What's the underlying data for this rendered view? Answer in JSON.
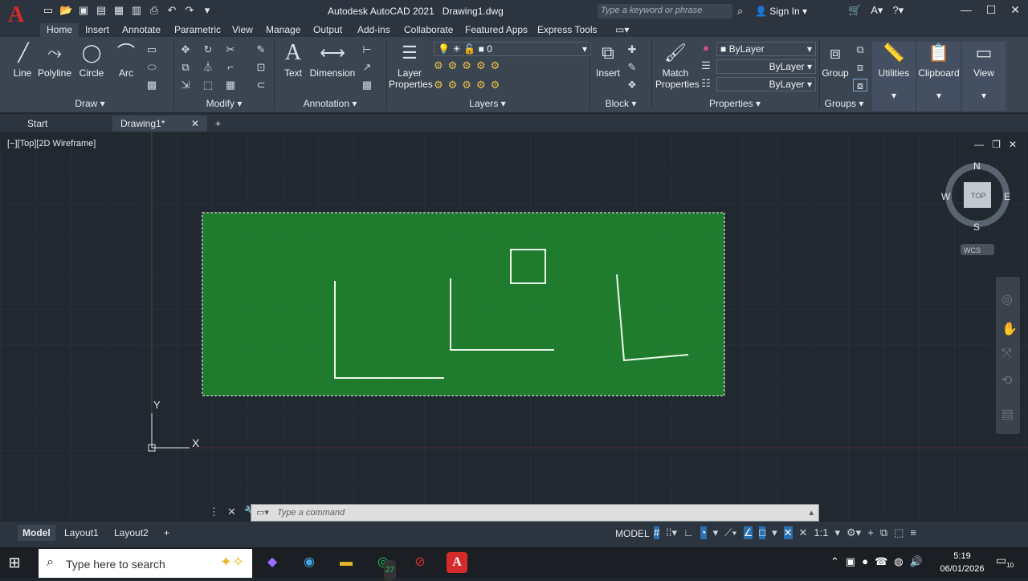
{
  "app": {
    "title": "Autodesk AutoCAD 2021",
    "document": "Drawing1.dwg",
    "search_placeholder": "Type a keyword or phrase",
    "sign_in": "Sign In",
    "logo_letter": "A"
  },
  "ribbon_tabs": [
    "Home",
    "Insert",
    "Annotate",
    "Parametric",
    "View",
    "Manage",
    "Output",
    "Add-ins",
    "Collaborate",
    "Featured Apps",
    "Express Tools"
  ],
  "draw": {
    "line": "Line",
    "polyline": "Polyline",
    "circle": "Circle",
    "arc": "Arc",
    "panel": "Draw"
  },
  "modify": {
    "panel": "Modify"
  },
  "annotation": {
    "text": "Text",
    "dimension": "Dimension",
    "panel": "Annotation"
  },
  "layers": {
    "layer_props_1": "Layer",
    "layer_props_2": "Properties",
    "current_layer": "0",
    "panel": "Layers"
  },
  "block": {
    "insert": "Insert",
    "panel": "Block"
  },
  "properties": {
    "match_1": "Match",
    "match_2": "Properties",
    "color": "ByLayer",
    "linetype": "ByLayer",
    "lineweight": "ByLayer",
    "panel": "Properties"
  },
  "groups": {
    "group": "Group",
    "panel": "Groups"
  },
  "utilities": "Utilities",
  "clipboard": "Clipboard",
  "view_panel": "View",
  "doc_tabs": {
    "start": "Start",
    "drawing": "Drawing1*"
  },
  "viewport": {
    "label": "[−][Top][2D Wireframe]"
  },
  "viewcube": {
    "n": "N",
    "s": "S",
    "e": "E",
    "w": "W",
    "face": "TOP",
    "wcs": "WCS"
  },
  "ucs": {
    "y": "Y",
    "x": "X"
  },
  "command": {
    "placeholder": "Type  a  command"
  },
  "layout_tabs": {
    "model": "Model",
    "layout1": "Layout1",
    "layout2": "Layout2"
  },
  "status": {
    "model": "MODEL",
    "scale": "1:1"
  },
  "taskbar": {
    "search": "Type here to search",
    "whatsapp_badge": "27",
    "time": "5:19",
    "date": "06/01/2026",
    "notif_count": "10"
  },
  "colors": {
    "selection_fill": "#1f8a2e",
    "geometry": "#eafaea",
    "autocad_red": "#d42a2a",
    "accent_blue": "#2a6fb0"
  }
}
